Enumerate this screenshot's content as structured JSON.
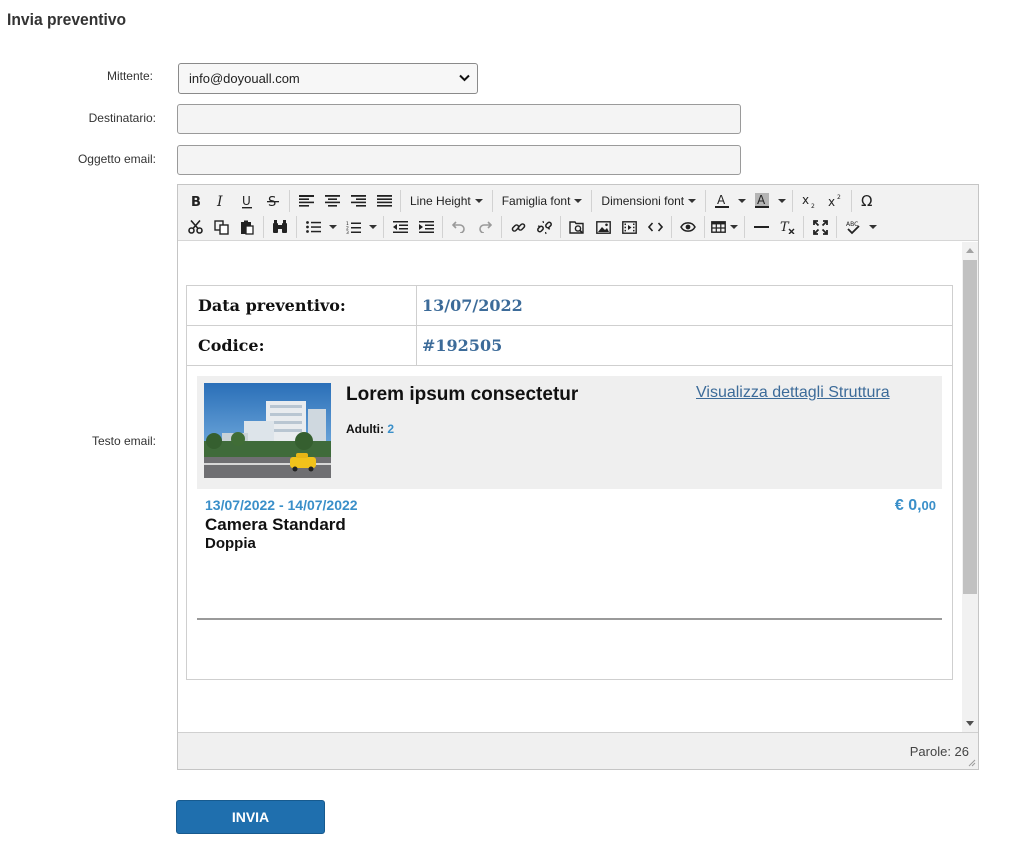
{
  "page": {
    "title": "Invia preventivo"
  },
  "form": {
    "sender_label": "Mittente:",
    "sender_value": "info@doyouall.com",
    "recipient_label": "Destinatario:",
    "recipient_value": "",
    "subject_label": "Oggetto email:",
    "subject_value": "",
    "body_label": "Testo email:"
  },
  "toolbar": {
    "line_height": "Line Height",
    "font_family": "Famiglia font",
    "font_size": "Dimensioni font",
    "row1_icons": [
      "bold-icon",
      "italic-icon",
      "underline-icon",
      "strikethrough-icon",
      "align-left-icon",
      "align-center-icon",
      "align-right-icon",
      "align-justify-icon",
      "text-color-icon",
      "background-color-icon",
      "subscript-icon",
      "superscript-icon",
      "special-character-icon"
    ],
    "row2_icons": [
      "cut-icon",
      "copy-icon",
      "paste-icon",
      "find-icon",
      "bullet-list-icon",
      "numbered-list-icon",
      "outdent-icon",
      "indent-icon",
      "undo-icon",
      "redo-icon",
      "link-icon",
      "unlink-icon",
      "browse-server-icon",
      "image-icon",
      "media-icon",
      "source-code-icon",
      "preview-icon",
      "table-icon",
      "horizontal-rule-icon",
      "clear-formatting-icon",
      "fullscreen-icon",
      "spellcheck-icon"
    ]
  },
  "email": {
    "date_label": "Data preventivo:",
    "date_value": "13/07/2022",
    "code_label": "Codice:",
    "code_value": "#192505",
    "hotel_name": "Lorem ipsum consectetur",
    "hotel_link": "Visualizza dettagli Struttura",
    "adults_label": "Adulti:",
    "adults_value": "2",
    "stay_dates": "13/07/2022 - 14/07/2022",
    "price_main": "€ 0,",
    "price_cents": "00",
    "room_name": "Camera Standard",
    "room_type": "Doppia"
  },
  "status": {
    "words": "Parole: 26"
  },
  "actions": {
    "send_label": "INVIA"
  },
  "colors": {
    "link": "#3c6b99",
    "accent": "#3a8fc9",
    "button": "#1f6fae"
  }
}
